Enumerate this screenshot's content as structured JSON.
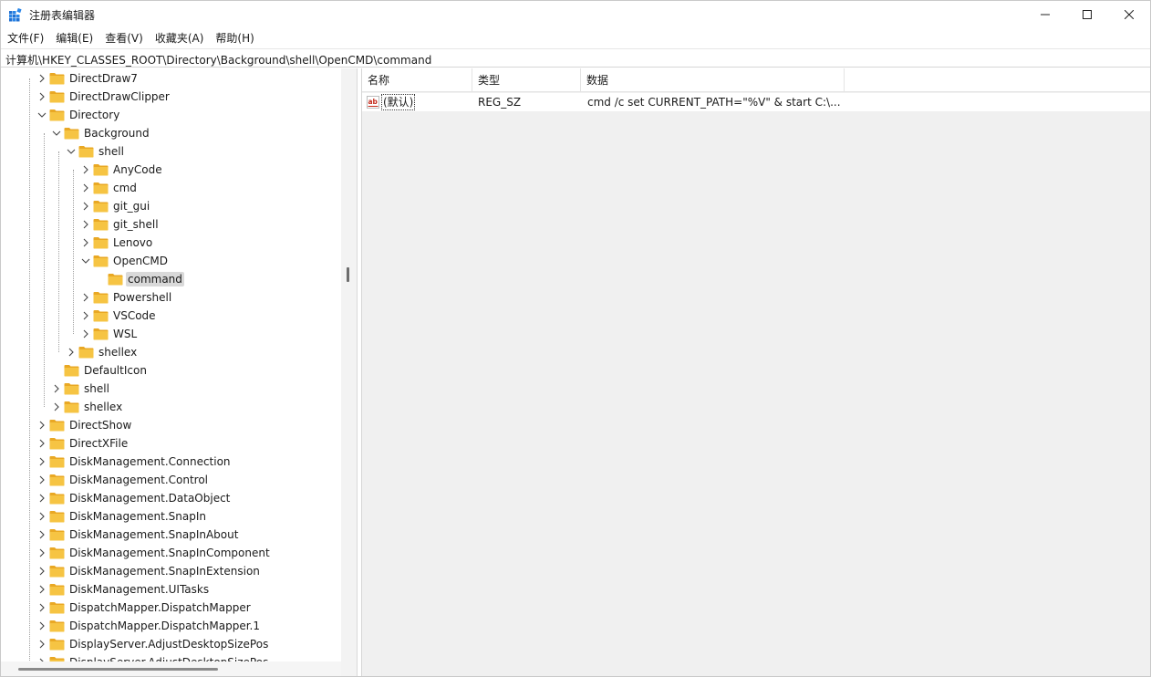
{
  "window": {
    "title": "注册表编辑器"
  },
  "menu": [
    "文件(F)",
    "编辑(E)",
    "查看(V)",
    "收藏夹(A)",
    "帮助(H)"
  ],
  "address": "计算机\\HKEY_CLASSES_ROOT\\Directory\\Background\\shell\\OpenCMD\\command",
  "tree": [
    {
      "label": "DirectDraw7",
      "expand": "collapsed"
    },
    {
      "label": "DirectDrawClipper",
      "expand": "collapsed"
    },
    {
      "label": "Directory",
      "expand": "expanded"
    },
    {
      "label": "Background",
      "expand": "expanded"
    },
    {
      "label": "shell",
      "expand": "expanded"
    },
    {
      "label": "AnyCode",
      "expand": "collapsed"
    },
    {
      "label": "cmd",
      "expand": "collapsed"
    },
    {
      "label": "git_gui",
      "expand": "collapsed"
    },
    {
      "label": "git_shell",
      "expand": "collapsed"
    },
    {
      "label": "Lenovo",
      "expand": "collapsed"
    },
    {
      "label": "OpenCMD",
      "expand": "expanded"
    },
    {
      "label": "command",
      "expand": "none",
      "selected": true
    },
    {
      "label": "Powershell",
      "expand": "collapsed"
    },
    {
      "label": "VSCode",
      "expand": "collapsed"
    },
    {
      "label": "WSL",
      "expand": "collapsed"
    },
    {
      "label": "shellex",
      "expand": "collapsed"
    },
    {
      "label": "DefaultIcon",
      "expand": "none"
    },
    {
      "label": "shell",
      "expand": "collapsed"
    },
    {
      "label": "shellex",
      "expand": "collapsed"
    },
    {
      "label": "DirectShow",
      "expand": "collapsed"
    },
    {
      "label": "DirectXFile",
      "expand": "collapsed"
    },
    {
      "label": "DiskManagement.Connection",
      "expand": "collapsed"
    },
    {
      "label": "DiskManagement.Control",
      "expand": "collapsed"
    },
    {
      "label": "DiskManagement.DataObject",
      "expand": "collapsed"
    },
    {
      "label": "DiskManagement.SnapIn",
      "expand": "collapsed"
    },
    {
      "label": "DiskManagement.SnapInAbout",
      "expand": "collapsed"
    },
    {
      "label": "DiskManagement.SnapInComponent",
      "expand": "collapsed"
    },
    {
      "label": "DiskManagement.SnapInExtension",
      "expand": "collapsed"
    },
    {
      "label": "DiskManagement.UITasks",
      "expand": "collapsed"
    },
    {
      "label": "DispatchMapper.DispatchMapper",
      "expand": "collapsed"
    },
    {
      "label": "DispatchMapper.DispatchMapper.1",
      "expand": "collapsed"
    },
    {
      "label": "DisplayServer.AdjustDesktopSizePos",
      "expand": "collapsed"
    },
    {
      "label": "DisplayServer.AdjustDesktopSizePos",
      "expand": "collapsed"
    }
  ],
  "list": {
    "columns": [
      "名称",
      "类型",
      "数据"
    ],
    "rows": [
      {
        "name": "(默认)",
        "type": "REG_SZ",
        "data": "cmd /c set CURRENT_PATH=\"%V\" & start C:\\..."
      }
    ]
  },
  "icons": {
    "app": "registry-editor-icon",
    "folder": "folder-icon",
    "value": "string-value-icon"
  },
  "colors": {
    "folder": "#f6c443",
    "selection": "#d9d9d9",
    "list_background": "#f0f0f0",
    "value_icon": "#c42b1c"
  }
}
